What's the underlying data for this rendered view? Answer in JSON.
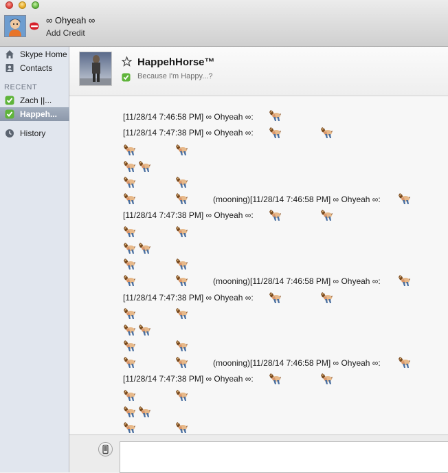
{
  "window": {
    "profile_name": "∞ Ohyeah ∞",
    "add_credit_label": "Add Credit"
  },
  "sidebar": {
    "nav": [
      {
        "label": "Skype Home",
        "icon": "home-icon"
      },
      {
        "label": "Contacts",
        "icon": "contacts-icon"
      }
    ],
    "recent_heading": "RECENT",
    "recent": [
      {
        "label": "Zach ||...",
        "icon": "online-check-icon"
      },
      {
        "label": "Happeh...",
        "icon": "online-check-icon",
        "selected": true
      }
    ],
    "history_label": "History"
  },
  "conversation": {
    "contact_name": "HappehHorse™",
    "mood": "Because I'm Happy...?"
  },
  "messages": {
    "first": "[11/28/14 7:46:58 PM] ∞ Ohyeah ∞:",
    "second": "[11/28/14 7:47:38 PM] ∞ Ohyeah ∞:",
    "mooning": "(mooning)[11/28/14 7:46:58 PM] ∞ Ohyeah ∞:",
    "emoticon": "mooning-horse-icon"
  },
  "composer": {
    "value": "",
    "phone_icon": "phone-icon"
  },
  "colors": {
    "online_green": "#5fb43a",
    "skype_red": "#d61f2a",
    "selection_blue": "#8c98aa"
  }
}
